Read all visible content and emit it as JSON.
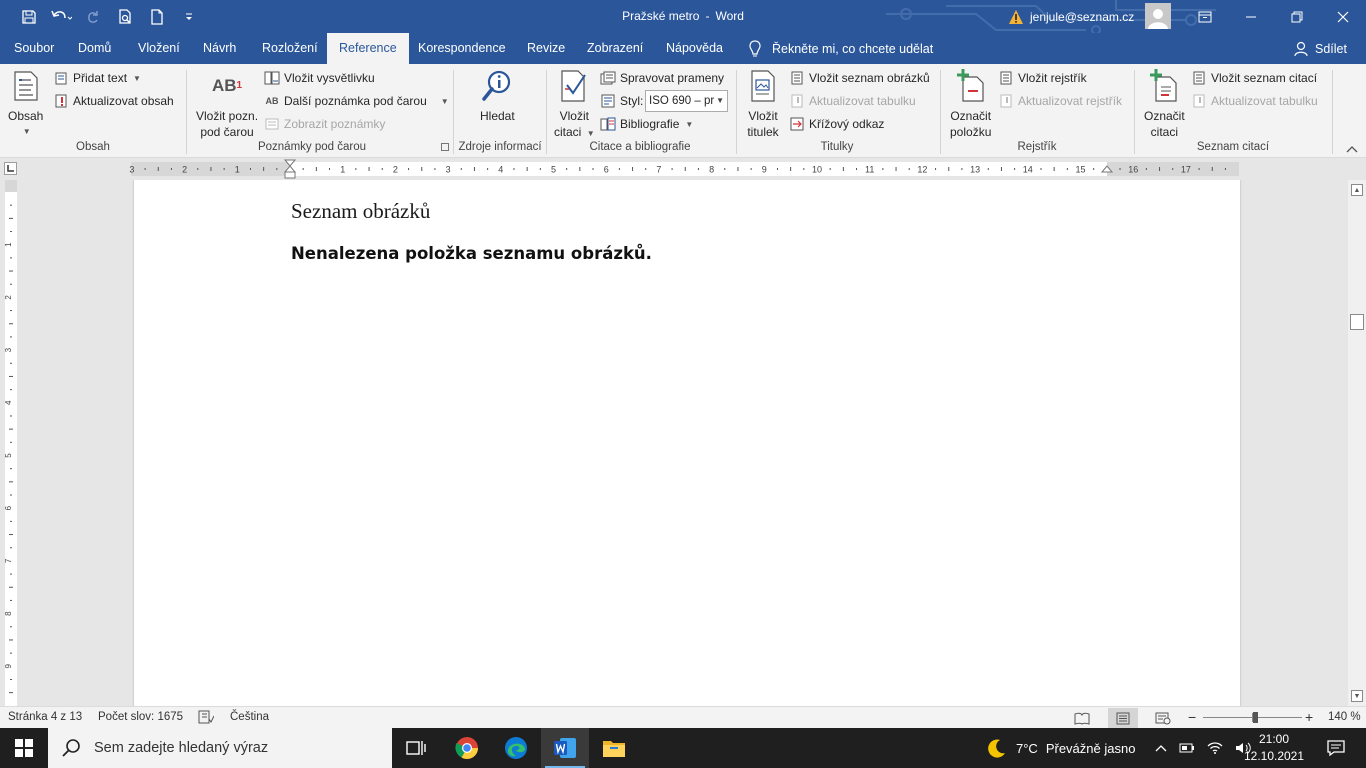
{
  "window": {
    "document_name": "Pražské metro",
    "separator": "-",
    "app_name": "Word",
    "account": "jenjule@seznam.cz"
  },
  "tabs": [
    {
      "label": "Soubor"
    },
    {
      "label": "Domů"
    },
    {
      "label": "Vložení"
    },
    {
      "label": "Návrh"
    },
    {
      "label": "Rozložení"
    },
    {
      "label": "Reference",
      "active": true
    },
    {
      "label": "Korespondence"
    },
    {
      "label": "Revize"
    },
    {
      "label": "Zobrazení"
    },
    {
      "label": "Nápověda"
    }
  ],
  "tell_me": "Řekněte mi, co chcete udělat",
  "share": "Sdílet",
  "ribbon": {
    "obsah": {
      "group_label": "Obsah",
      "obsah_btn": "Obsah",
      "pridat_text": "Přidat text",
      "aktualizovat_obsah": "Aktualizovat obsah"
    },
    "poznamky": {
      "group_label": "Poznámky pod čarou",
      "vlozit_pozn_1": "Vložit pozn.",
      "vlozit_pozn_2": "pod čarou",
      "icon_text": "AB",
      "icon_sup": "1",
      "vlozit_vysvetlivku": "Vložit vysvětlivku",
      "dalsi_poznamka": "Další poznámka pod čarou",
      "zobrazit_poznamky": "Zobrazit poznámky"
    },
    "zdroje": {
      "group_label": "Zdroje informací",
      "hledat": "Hledat"
    },
    "citace": {
      "group_label": "Citace a bibliografie",
      "vlozit_citaci_1": "Vložit",
      "vlozit_citaci_2": "citaci",
      "spravovat_prameny": "Spravovat prameny",
      "styl_label": "Styl:",
      "styl_value": "ISO 690 – pr",
      "bibliografie": "Bibliografie"
    },
    "titulky": {
      "group_label": "Titulky",
      "vlozit_titulek_1": "Vložit",
      "vlozit_titulek_2": "titulek",
      "vlozit_seznam_obrazku": "Vložit seznam obrázků",
      "aktualizovat_tabulku": "Aktualizovat tabulku",
      "krizovy_odkaz": "Křížový odkaz"
    },
    "rejstrik": {
      "group_label": "Rejstřík",
      "oznacit_polozku_1": "Označit",
      "oznacit_polozku_2": "položku",
      "vlozit_rejstrik": "Vložit rejstřík",
      "aktualizovat_rejstrik": "Aktualizovat rejstřík"
    },
    "seznam_citaci": {
      "group_label": "Seznam citací",
      "oznacit_citaci_1": "Označit",
      "oznacit_citaci_2": "citaci",
      "vlozit_seznam_citaci": "Vložit seznam citací",
      "aktualizovat_tabulku": "Aktualizovat tabulku"
    }
  },
  "ruler": {
    "h_labels": [
      "3",
      "2",
      "1",
      "1",
      "2",
      "3",
      "4",
      "5",
      "6",
      "7",
      "8",
      "9",
      "10",
      "11",
      "12",
      "13",
      "14",
      "15",
      "16",
      "17"
    ],
    "v_labels": [
      "1",
      "2",
      "3",
      "4",
      "5",
      "6",
      "7",
      "8",
      "9"
    ]
  },
  "document": {
    "heading": "Seznam obrázků",
    "body": "Nenalezena položka seznamu obrázků."
  },
  "statusbar": {
    "page": "Stránka 4 z 13",
    "words": "Počet slov: 1675",
    "language": "Čeština",
    "zoom": "140 %",
    "zoom_minus": "−",
    "zoom_plus": "+"
  },
  "taskbar": {
    "search_placeholder": "Sem zadejte hledaný výraz",
    "weather_temp": "7°C",
    "weather_text": "Převážně jasno",
    "time": "21:00",
    "date": "12.10.2021"
  },
  "colors": {
    "word_blue": "#2b579a",
    "ribbon_bg": "#f3f3f3",
    "doc_bg": "#e6e6e6",
    "taskbar": "#1f1f1f"
  }
}
